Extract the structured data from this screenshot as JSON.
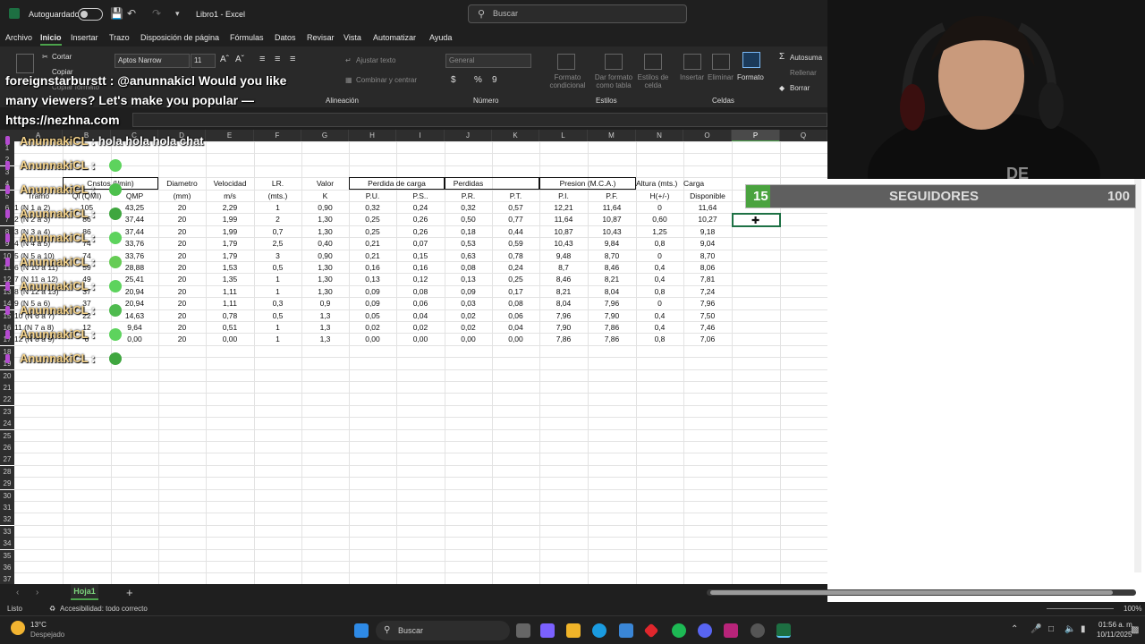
{
  "titlebar": {
    "autosave_label": "Autoguardado",
    "doc_title": "Libro1  -  Excel",
    "search_placeholder": "Buscar"
  },
  "menu": [
    "Archivo",
    "Inicio",
    "Insertar",
    "Trazo",
    "Disposición de página",
    "Fórmulas",
    "Datos",
    "Revisar",
    "Vista",
    "Automatizar",
    "Ayuda"
  ],
  "ribbon": {
    "cut": "Cortar",
    "copy": "Copiar",
    "copy_format": "Copiar formato",
    "font_name": "Aptos Narrow",
    "font_size": "11",
    "wrap": "Ajustar texto",
    "merge": "Combinar y centrar",
    "number_format": "General",
    "cond_format": "Formato condicional",
    "table_format": "Dar formato como tabla",
    "cell_styles": "Estilos de celda",
    "insert": "Insertar",
    "delete": "Eliminar",
    "format": "Formato",
    "autosum": "Autosuma",
    "fill": "Rellenar",
    "clear": "Borrar",
    "groups": {
      "alignment": "Alineación",
      "number": "Número",
      "styles": "Estilos",
      "cells": "Celdas"
    }
  },
  "columns": [
    "E",
    "F",
    "G",
    "H",
    "I",
    "J",
    "K",
    "L",
    "M",
    "N",
    "O",
    "P",
    "Q"
  ],
  "selected_column": "P",
  "row_numbers": [
    "5",
    "6",
    "7",
    "8",
    "9",
    "10",
    "11",
    "12",
    "13",
    "14",
    "15",
    "16",
    "17",
    "18",
    "19",
    "20",
    "21",
    "22",
    "23",
    "24",
    "25",
    "26",
    "27",
    "28",
    "29",
    "30",
    "31",
    "32",
    "33",
    "34",
    "35",
    "36",
    "37"
  ],
  "table": {
    "group_headers": {
      "caudal": "Cnstos (l/min)",
      "perdida": "Perdida de carga",
      "perdidas": "Perdidas",
      "presion": "Presion (M.C.A.)",
      "altura": "Altura (mts.)",
      "carga": "Carga"
    },
    "header_row1": {
      "d": "Diametro",
      "e": "Velocidad",
      "f": "LR.",
      "g": "Valor"
    },
    "header_row2": [
      "Tramo",
      "Ql (QMI)",
      "QMP",
      "(mm)",
      "m/s",
      "(mts.)",
      "K",
      "P.U.",
      "P.S..",
      "P.R.",
      "P.T.",
      "P.I.",
      "P.F.",
      "H(+/-)",
      "Disponible"
    ],
    "rows": [
      [
        "1 (N 1 a 2)",
        "105",
        "43,25",
        "20",
        "2,29",
        "1",
        "0,90",
        "0,32",
        "0,24",
        "0,32",
        "0,57",
        "12,21",
        "11,64",
        "0",
        "11,64"
      ],
      [
        "2 (N 2 a 3)",
        "86",
        "37,44",
        "20",
        "1,99",
        "2",
        "1,30",
        "0,25",
        "0,26",
        "0,50",
        "0,77",
        "11,64",
        "10,87",
        "0,60",
        "10,27"
      ],
      [
        "3 (N 3 a 4)",
        "86",
        "37,44",
        "20",
        "1,99",
        "0,7",
        "1,30",
        "0,25",
        "0,26",
        "0,18",
        "0,44",
        "10,87",
        "10,43",
        "1,25",
        "9,18"
      ],
      [
        "4 (N 4 a 5)",
        "74",
        "33,76",
        "20",
        "1,79",
        "2,5",
        "0,40",
        "0,21",
        "0,07",
        "0,53",
        "0,59",
        "10,43",
        "9,84",
        "0,8",
        "9,04"
      ],
      [
        "5 (N 5 a 10)",
        "74",
        "33,76",
        "20",
        "1,79",
        "3",
        "0,90",
        "0,21",
        "0,15",
        "0,63",
        "0,78",
        "9,48",
        "8,70",
        "0",
        "8,70"
      ],
      [
        "6 (N 10 a 11)",
        "59",
        "28,88",
        "20",
        "1,53",
        "0,5",
        "1,30",
        "0,16",
        "0,16",
        "0,08",
        "0,24",
        "8,7",
        "8,46",
        "0,4",
        "8,06"
      ],
      [
        "7 (N 11 a 12)",
        "49",
        "25,41",
        "20",
        "1,35",
        "1",
        "1,30",
        "0,13",
        "0,12",
        "0,13",
        "0,25",
        "8,46",
        "8,21",
        "0,4",
        "7,81"
      ],
      [
        "8 (N 12 a 13)",
        "37",
        "20,94",
        "20",
        "1,11",
        "1",
        "1,30",
        "0,09",
        "0,08",
        "0,09",
        "0,17",
        "8,21",
        "8,04",
        "0,8",
        "7,24"
      ],
      [
        "9 (N 5 a 6)",
        "37",
        "20,94",
        "20",
        "1,11",
        "0,3",
        "0,9",
        "0,09",
        "0,06",
        "0,03",
        "0,08",
        "8,04",
        "7,96",
        "0",
        "7,96"
      ],
      [
        "10 (N 6 a 7)",
        "22",
        "14,63",
        "20",
        "0,78",
        "0,5",
        "1,3",
        "0,05",
        "0,04",
        "0,02",
        "0,06",
        "7,96",
        "7,90",
        "0,4",
        "7,50"
      ],
      [
        "11 (N 7 a 8)",
        "12",
        "9,64",
        "20",
        "0,51",
        "1",
        "1,3",
        "0,02",
        "0,02",
        "0,02",
        "0,04",
        "7,90",
        "7,86",
        "0,4",
        "7,46"
      ],
      [
        "12 (N 8 a 9)",
        "0",
        "0,00",
        "20",
        "0,00",
        "1",
        "1,3",
        "0,00",
        "0,00",
        "0,00",
        "0,00",
        "7,86",
        "7,86",
        "0,8",
        "7,06"
      ]
    ]
  },
  "overlay": {
    "count": "15",
    "label": "SEGUIDORES",
    "goal": "100",
    "progress": 0.15
  },
  "chat": [
    {
      "user": "AnunnakiCL",
      "text": ": hola hola hola chat"
    },
    {
      "user": "foreignstarburstt",
      "text": ": @anunnakicl Would you like many viewers? Let's make you popular — https://nezhna.com"
    },
    {
      "user": "AnunnakiCL",
      "text": ":"
    }
  ],
  "sheet_tab": "Hoja1",
  "status": {
    "ready": "Listo",
    "accessibility": "Accesibilidad: todo correcto",
    "zoom": "100%"
  },
  "taskbar": {
    "temp": "13°C",
    "weather": "Despejado",
    "search": "Buscar",
    "time": "01:56 a. m.",
    "date": "10/11/2025"
  },
  "colors": {
    "accent": "#4ca34c",
    "excel_green": "#1d6f42",
    "progress_fill": "#4aa33f"
  }
}
